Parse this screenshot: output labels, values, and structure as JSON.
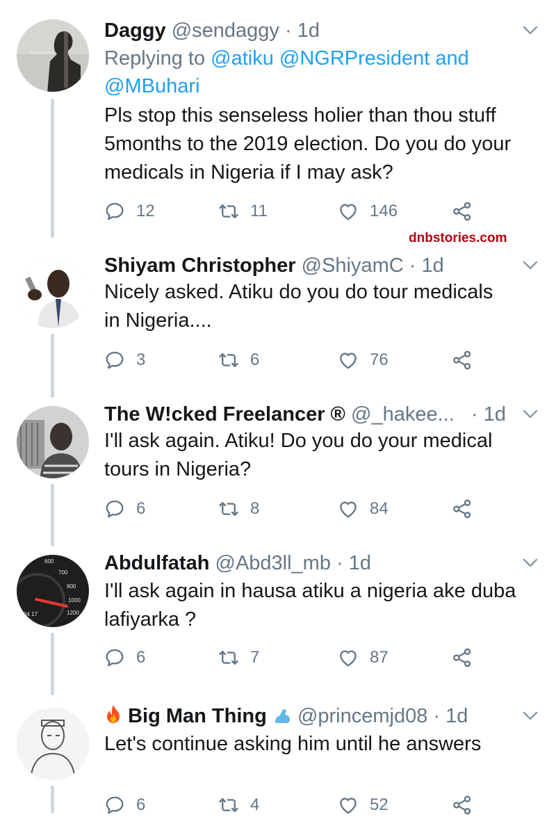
{
  "watermark": "dnbstories.com",
  "tweets": [
    {
      "name": "Daggy",
      "handle": "@sendaggy",
      "separator": "·",
      "time": "1d",
      "reply_prefix": "Replying to",
      "reply_line1_links": "@atiku @NGRPresident",
      "reply_and": "and",
      "reply_line2_link": "@MBuhari",
      "body_lines": [
        "Pls stop this senseless holier than thou stuff",
        "5months to the 2019 election. Do you do your",
        "medicals in Nigeria if I may ask?"
      ],
      "replies": "12",
      "retweets": "11",
      "likes": "146"
    },
    {
      "name": "Shiyam Christopher",
      "handle": "@ShiyamC",
      "separator": "·",
      "time": "1d",
      "body_lines": [
        "Nicely asked. Atiku do you do tour medicals",
        "in Nigeria...."
      ],
      "replies": "3",
      "retweets": "6",
      "likes": "76"
    },
    {
      "name": "The W!cked Freelancer ®",
      "handle": "@_hakee...",
      "separator": "·",
      "time": "1d",
      "body_lines": [
        "I'll ask again. Atiku! Do you do your medical",
        "tours in Nigeria?"
      ],
      "replies": "6",
      "retweets": "8",
      "likes": "84"
    },
    {
      "name": "Abdulfatah",
      "handle": "@Abd3ll_mb",
      "separator": "·",
      "time": "1d",
      "body_lines": [
        "I'll ask again in hausa atiku a nigeria ake duba",
        "lafiyarka ?"
      ],
      "replies": "6",
      "retweets": "7",
      "likes": "87"
    },
    {
      "name": "Big Man Thing",
      "handle": "@princemjd08",
      "separator": "·",
      "time": "1d",
      "body_lines": [
        "Let's continue asking him until he answers"
      ],
      "replies": "6",
      "retweets": "4",
      "likes": "52"
    }
  ],
  "icons": {
    "reply": "speech-bubble-icon",
    "retweet": "retweet-arrows-icon",
    "like": "heart-icon",
    "share": "share-nodes-icon",
    "menu": "chevron-down-icon",
    "fire": "fire-emoji-icon",
    "muscle": "flexed-biceps-emoji-icon"
  },
  "colors": {
    "link": "#1da1f2",
    "muted": "#657786",
    "text": "#14171a",
    "watermark": "#b8000f",
    "thread": "#cfd6dc"
  }
}
